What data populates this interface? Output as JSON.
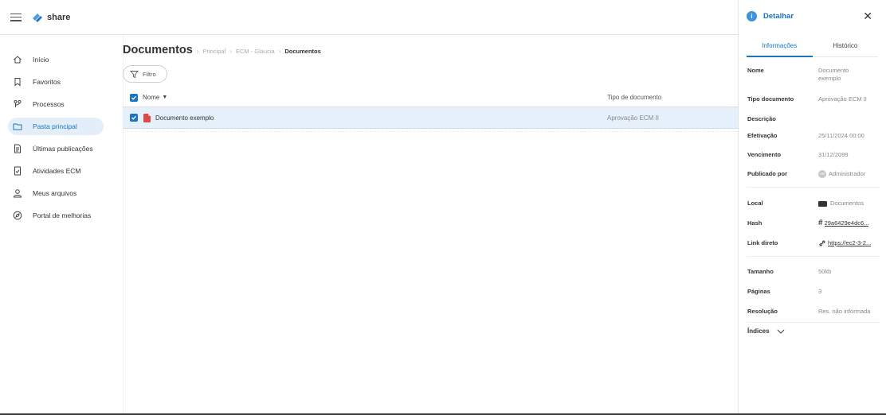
{
  "app": {
    "logo_text": "share"
  },
  "sidebar": {
    "items": [
      {
        "label": "Início",
        "icon": "home-icon"
      },
      {
        "label": "Favoritos",
        "icon": "bookmark-icon"
      },
      {
        "label": "Processos",
        "icon": "workflow-icon"
      },
      {
        "label": "Pasta principal",
        "icon": "folder-icon",
        "active": true
      },
      {
        "label": "Últimas publicações",
        "icon": "document-icon"
      },
      {
        "label": "Atividades ECM",
        "icon": "task-check-icon"
      },
      {
        "label": "Meus arquivos",
        "icon": "user-icon"
      },
      {
        "label": "Portal de melhorias",
        "icon": "compass-icon"
      }
    ]
  },
  "main": {
    "title": "Documentos",
    "breadcrumb": [
      "Principal",
      "ECM - Glaucia",
      "Documentos"
    ],
    "filter_label": "Filtro",
    "table": {
      "columns": [
        "Nome",
        "Tipo de documento"
      ],
      "rows": [
        {
          "name": "Documento exemplo",
          "type": "Aprovação ECM II"
        }
      ]
    }
  },
  "panel": {
    "title": "Detalhar",
    "tabs": [
      "Informações",
      "Histórico"
    ],
    "props": {
      "nome_k": "Nome",
      "nome_v": "Documento exemplo",
      "tipo_k": "Tipo documento",
      "tipo_v": "Aprovação ECM II",
      "descricao_k": "Descrição",
      "efetivacao_k": "Efetivação",
      "efetivacao_v": "25/11/2024 00:00",
      "vencimento_k": "Vencimento",
      "vencimento_v": "31/12/2099",
      "publicado_k": "Publicado por",
      "publicado_avatar": "AD",
      "publicado_v": "Administrador",
      "local_k": "Local",
      "local_v": "Documentos",
      "hash_k": "Hash",
      "hash_v": "29a6429e4dc6...",
      "link_k": "Link direto",
      "link_v": "https://ec2-3-2...",
      "tamanho_k": "Tamanho",
      "tamanho_v": "50kb",
      "paginas_k": "Páginas",
      "paginas_v": "3",
      "resolucao_k": "Resolução",
      "resolucao_v": "Res. não informada"
    },
    "indices_label": "Índices"
  },
  "colors": {
    "accent": "#1a74c2",
    "selected_row": "#e6f0fb",
    "nav_active": "#e3eef9"
  }
}
